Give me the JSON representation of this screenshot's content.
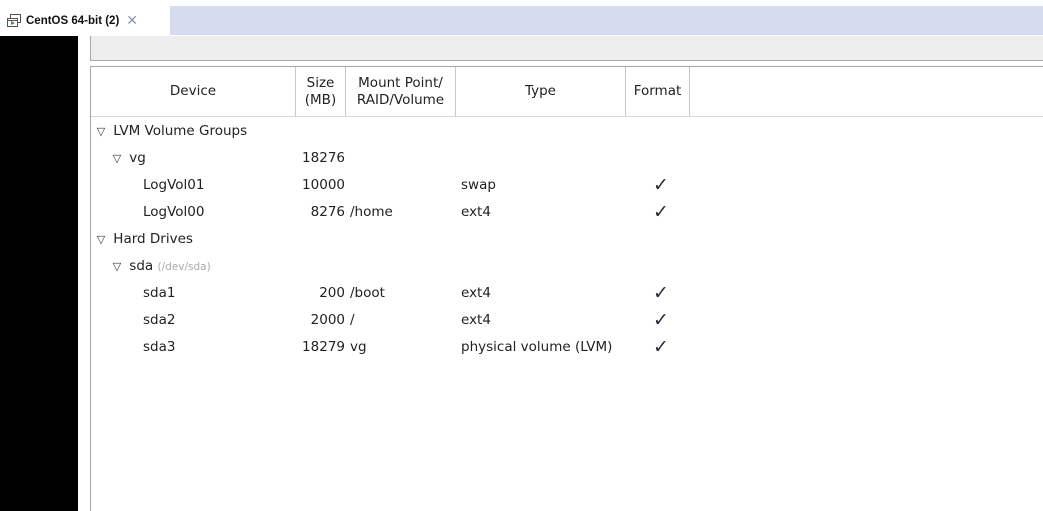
{
  "tab": {
    "title": "CentOS 64-bit (2)",
    "close_glyph": "✕",
    "icon": "vm-console-icon"
  },
  "table": {
    "headers": {
      "device": "Device",
      "size": "Size\n(MB)",
      "mount": "Mount Point/\nRAID/Volume",
      "type": "Type",
      "format": "Format"
    },
    "rows": [
      {
        "level": 0,
        "expander": "▽",
        "device": "LVM Volume Groups",
        "detail": "",
        "size": "",
        "mount": "",
        "type": "",
        "format": false
      },
      {
        "level": 1,
        "expander": "▽",
        "device": "vg",
        "detail": "",
        "size": "18276",
        "mount": "",
        "type": "",
        "format": false
      },
      {
        "level": 2,
        "expander": "",
        "device": "LogVol01",
        "detail": "",
        "size": "10000",
        "mount": "",
        "type": "swap",
        "format": true
      },
      {
        "level": 2,
        "expander": "",
        "device": "LogVol00",
        "detail": "",
        "size": "8276",
        "mount": "/home",
        "type": "ext4",
        "format": true
      },
      {
        "level": 0,
        "expander": "▽",
        "device": "Hard Drives",
        "detail": "",
        "size": "",
        "mount": "",
        "type": "",
        "format": false
      },
      {
        "level": 1,
        "expander": "▽",
        "device": "sda",
        "detail": "(/dev/sda)",
        "size": "",
        "mount": "",
        "type": "",
        "format": false
      },
      {
        "level": 2,
        "expander": "",
        "device": "sda1",
        "detail": "",
        "size": "200",
        "mount": "/boot",
        "type": "ext4",
        "format": true
      },
      {
        "level": 2,
        "expander": "",
        "device": "sda2",
        "detail": "",
        "size": "2000",
        "mount": "/",
        "type": "ext4",
        "format": true
      },
      {
        "level": 2,
        "expander": "",
        "device": "sda3",
        "detail": "",
        "size": "18279",
        "mount": "vg",
        "type": "physical volume (LVM)",
        "format": true
      }
    ],
    "check_glyph": "✓"
  },
  "colors": {
    "tab_strip": "#d4dcee",
    "guest_border": "#000000",
    "check": "#2a2a3c"
  }
}
